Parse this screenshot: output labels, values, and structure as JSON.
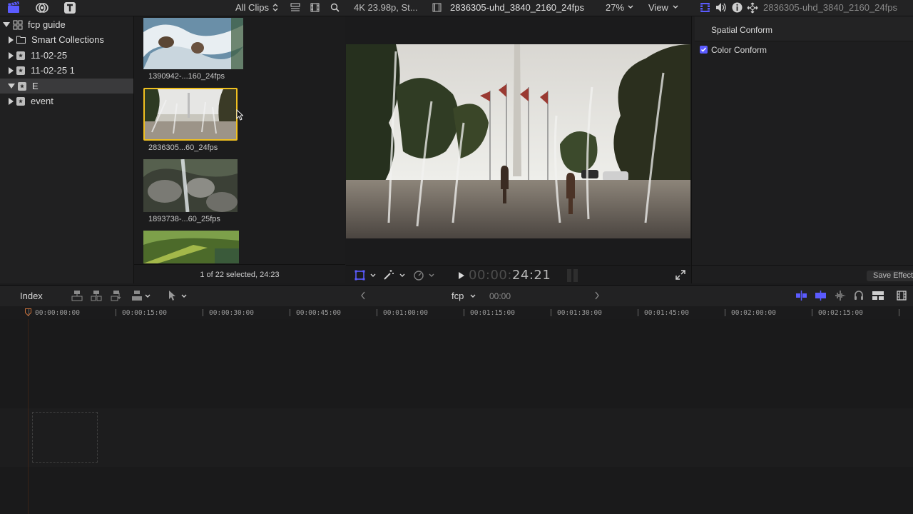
{
  "topbar": {
    "filter_label": "All Clips",
    "viewer_format": "4K 23.98p, St...",
    "viewer_clip_name": "2836305-uhd_3840_2160_24fps",
    "zoom": "27%",
    "view_label": "View",
    "inspector_clip_name": "2836305-uhd_3840_2160_24fps"
  },
  "library": {
    "name": "fcp guide",
    "items": [
      {
        "label": "Smart Collections"
      },
      {
        "label": "11-02-25"
      },
      {
        "label": "11-02-25 1"
      },
      {
        "label": "E"
      },
      {
        "label": "event"
      }
    ]
  },
  "browser": {
    "clips": [
      {
        "label": "1390942-...160_24fps"
      },
      {
        "label": "2836305...60_24fps"
      },
      {
        "label": "1893738-...60_25fps"
      }
    ],
    "status": "1 of 22 selected, 24:23"
  },
  "viewer": {
    "timecode_dim": "00:00:",
    "timecode_bright": "24:21"
  },
  "inspector": {
    "spatial_conform_label": "Spatial Conform",
    "color_conform_label": "Color Conform",
    "save_effects_label": "Save Effect"
  },
  "timeline": {
    "index_label": "Index",
    "project_name": "fcp",
    "project_time": "00:00",
    "ruler": [
      "00:00:00:00",
      "00:00:15:00",
      "00:00:30:00",
      "00:00:45:00",
      "00:01:00:00",
      "00:01:15:00",
      "00:01:30:00",
      "00:01:45:00",
      "00:02:00:00",
      "00:02:15:00"
    ]
  },
  "colors": {
    "accent": "#5b5bff",
    "selection_border": "#f0c020",
    "playhead": "#c7703a"
  },
  "icons": [
    "clapper-icon",
    "music-icon",
    "titles-icon",
    "chevron-updown-icon",
    "list-view-icon",
    "filmstrip-icon",
    "search-icon",
    "video-inspector-icon",
    "audio-inspector-icon",
    "info-icon",
    "transform-icon",
    "checkbox-icon",
    "transform-tool-icon",
    "magic-wand-icon",
    "speed-icon",
    "play-icon",
    "fullscreen-icon",
    "append-icon",
    "insert-icon",
    "overwrite-icon",
    "connect-icon",
    "select-tool-icon",
    "back-arrow-icon",
    "forward-arrow-icon",
    "skimming-icon",
    "audio-skimming-icon",
    "solo-icon",
    "snapping-icon",
    "clip-appearance-icon"
  ]
}
